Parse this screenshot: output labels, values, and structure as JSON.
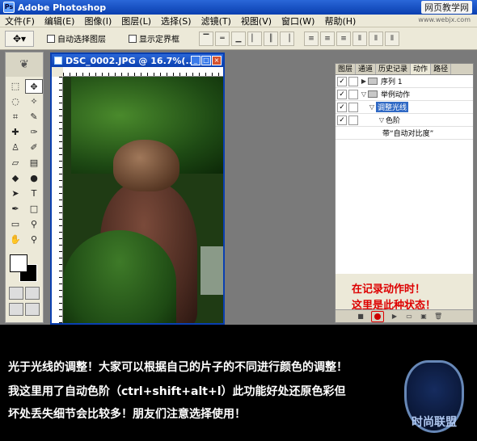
{
  "window": {
    "title": "Adobe Photoshop",
    "watermark": "网页教学网",
    "watermark_url": "www.webjx.com"
  },
  "menu": [
    "文件(F)",
    "编辑(E)",
    "图像(I)",
    "图层(L)",
    "选择(S)",
    "滤镜(T)",
    "视图(V)",
    "窗口(W)",
    "帮助(H)"
  ],
  "options": {
    "auto_select_label": "自动选择图层",
    "show_bounds_label": "显示定界框"
  },
  "document": {
    "title": "DSC_0002.JPG @ 16.7%(..."
  },
  "panel": {
    "tabs": [
      "图层",
      "通道",
      "历史记录",
      "动作",
      "路径"
    ],
    "active_tab": "动作",
    "actions": [
      {
        "label": "序列 1",
        "checked": true,
        "indent": 0,
        "expanded": false
      },
      {
        "label": "举例动作",
        "checked": true,
        "indent": 1,
        "expanded": true
      },
      {
        "label": "调整光线",
        "checked": true,
        "indent": 2,
        "expanded": true,
        "selected": true
      },
      {
        "label": "色阶",
        "checked": true,
        "indent": 3,
        "expanded": true
      },
      {
        "label": "带“自动对比度”",
        "checked": false,
        "indent": 4,
        "expanded": false
      }
    ],
    "note_line1": "在记录动作时！",
    "note_line2": "这里是此种状态！"
  },
  "caption": {
    "line1": "光于光线的调整！大家可以根据自己的片子的不同进行颜色的调整！",
    "line2": "我这里用了自动色阶（ctrl+shift+alt+l）此功能好处还原色彩但",
    "line3": "坏处丢失细节会比较多！朋友们注意选择使用！"
  },
  "logo": {
    "text": "时尚联盟"
  }
}
